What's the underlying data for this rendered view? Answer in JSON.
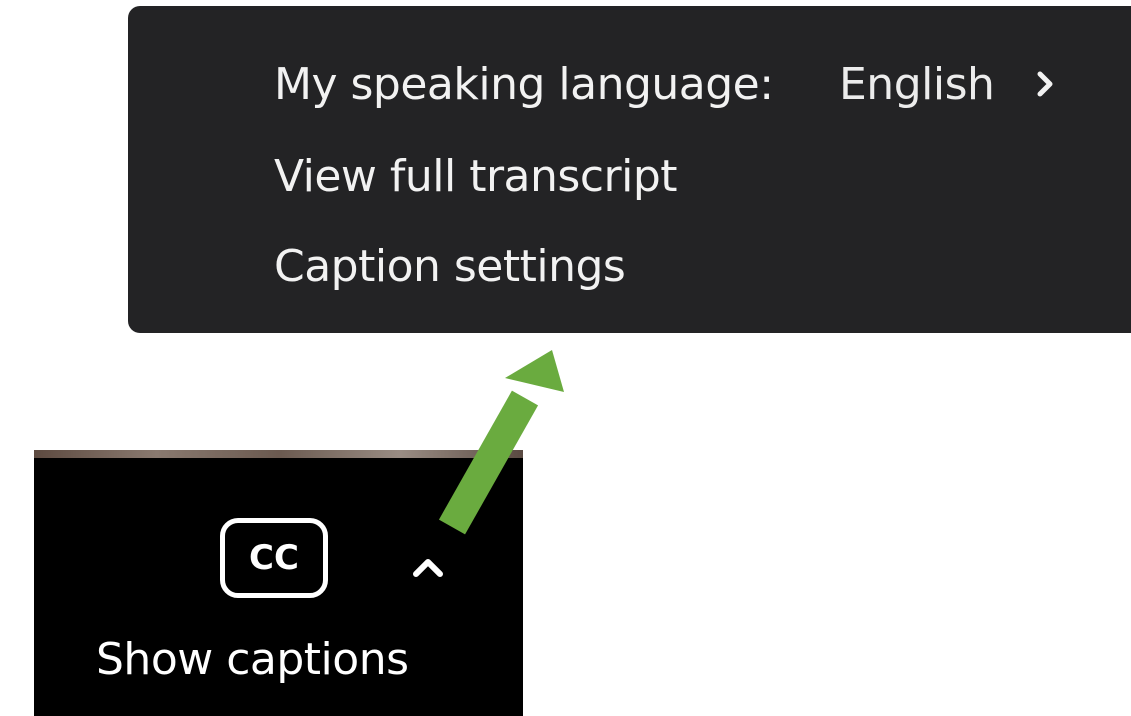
{
  "caption_menu": {
    "items": [
      {
        "label": "My speaking language:",
        "value": "English",
        "has_submenu": true,
        "icon": "chevron-right-icon"
      },
      {
        "label": "View full transcript"
      },
      {
        "label": "Caption settings"
      }
    ]
  },
  "toolbar": {
    "cc_button_label": "CC",
    "options_icon": "chevron-up-icon",
    "show_captions_label": "Show captions"
  },
  "colors": {
    "menu_background": "#232325",
    "menu_text": "#f2f2f2",
    "toolbar_background": "#000000",
    "annotation_arrow": "#6aab3f"
  }
}
